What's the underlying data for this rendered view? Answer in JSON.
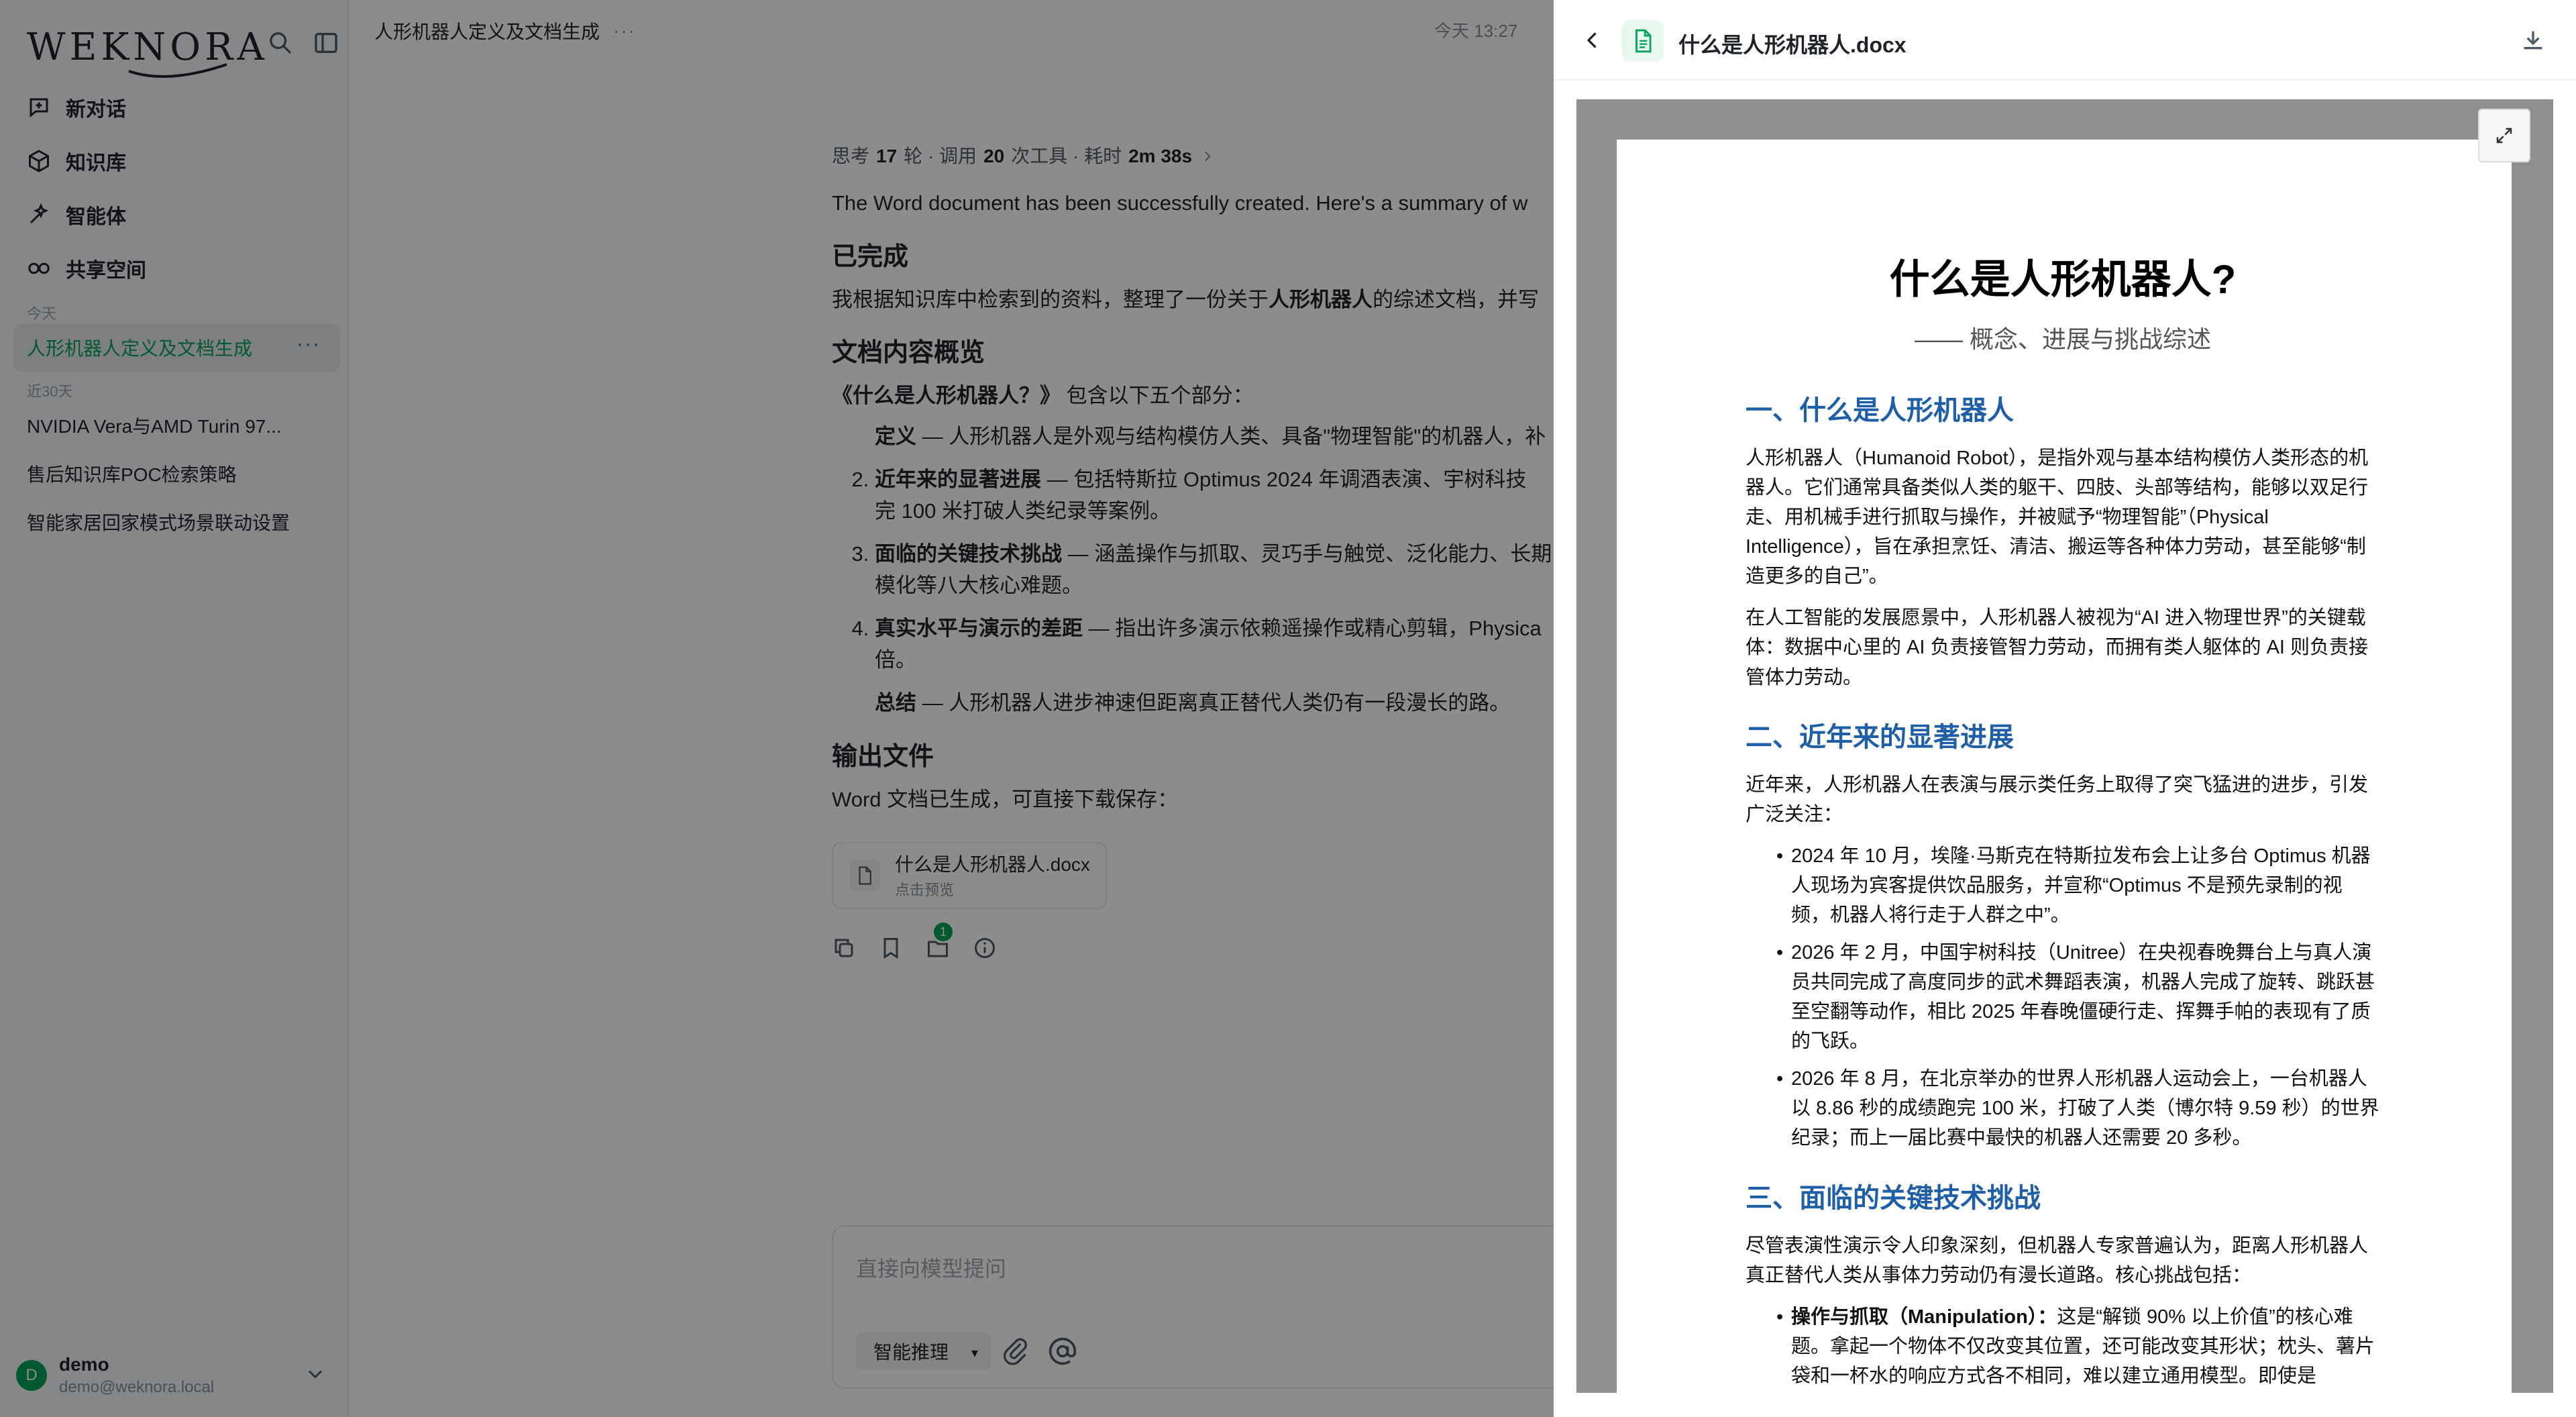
{
  "sidebar": {
    "logo": "WEKNORA",
    "nav": [
      {
        "label": "新对话"
      },
      {
        "label": "知识库"
      },
      {
        "label": "智能体"
      },
      {
        "label": "共享空间"
      }
    ],
    "section_today": "今天",
    "section_30days": "近30天",
    "active_conversation": "人形机器人定义及文档生成",
    "conversations": [
      "NVIDIA Vera与AMD Turin 97...",
      "售后知识库POC检索策略",
      "智能家居回家模式场景联动设置"
    ],
    "user": {
      "initial": "D",
      "name": "demo",
      "email": "demo@weknora.local"
    }
  },
  "chat": {
    "title": "人形机器人定义及文档生成",
    "time": "今天 13:27",
    "thinking": {
      "prefix": "思考",
      "rounds": "17",
      "rounds_unit": "轮 · 调用",
      "tools": "20",
      "tools_unit": "次工具 · 耗时",
      "duration": "2m 38s"
    },
    "intro": "The Word document has been successfully created. Here's a summary of w",
    "done_heading": "已完成",
    "done_text_a": "我根据知识库中检索到的资料，整理了一份关于",
    "done_text_b": "人形机器人",
    "done_text_c": "的综述文档，并写",
    "overview_heading": "文档内容概览",
    "overview_title": "《什么是人形机器人？》",
    "overview_text": " 包含以下五个部分：",
    "items": [
      {
        "term": "定义",
        "desc": " — 人形机器人是外观与结构模仿人类、具备\"物理智能\"的机器人，补"
      },
      {
        "term": "近年来的显著进展",
        "desc": " — 包括特斯拉 Optimus 2024 年调酒表演、宇树科技",
        "desc2": "完 100 米打破人类纪录等案例。"
      },
      {
        "term": "面临的关键技术挑战",
        "desc": " — 涵盖操作与抓取、灵巧手与触觉、泛化能力、长期",
        "desc2": "模化等八大核心难题。"
      },
      {
        "term": "真实水平与演示的差距",
        "desc": " — 指出许多演示依赖遥操作或精心剪辑，Physica",
        "desc2": "倍。"
      },
      {
        "term": "总结",
        "desc": " — 人形机器人进步神速但距离真正替代人类仍有一段漫长的路。"
      }
    ],
    "output_heading": "输出文件",
    "output_text": "Word 文档已生成，可直接下载保存：",
    "file_name": "什么是人形机器人.docx",
    "file_sub": "点击预览",
    "badge": "1",
    "composer_placeholder": "直接向模型提问",
    "mode_label": "智能推理"
  },
  "preview": {
    "title": "什么是人形机器人.docx",
    "doc": {
      "title": "什么是人形机器人?",
      "subtitle": "—— 概念、进展与挑战综述",
      "h1": "一、什么是人形机器人",
      "p1": "人形机器人（Humanoid Robot），是指外观与基本结构模仿人类形态的机器人。它们通常具备类似人类的躯干、四肢、头部等结构，能够以双足行走、用机械手进行抓取与操作，并被赋予“物理智能”（Physical Intelligence），旨在承担烹饪、清洁、搬运等各种体力劳动，甚至能够“制造更多的自己”。",
      "p2": "在人工智能的发展愿景中，人形机器人被视为“AI 进入物理世界”的关键载体：数据中心里的 AI 负责接管智力劳动，而拥有类人躯体的 AI 则负责接管体力劳动。",
      "h2": "二、近年来的显著进展",
      "p3": "近年来，人形机器人在表演与展示类任务上取得了突飞猛进的进步，引发广泛关注：",
      "bullets": [
        "2024 年 10 月，埃隆·马斯克在特斯拉发布会上让多台 Optimus 机器人现场为宾客提供饮品服务，并宣称“Optimus 不是预先录制的视频，机器人将行走于人群之中”。",
        "2026 年 2 月，中国宇树科技（Unitree）在央视春晚舞台上与真人演员共同完成了高度同步的武术舞蹈表演，机器人完成了旋转、跳跃甚至空翻等动作，相比 2025 年春晚僵硬行走、挥舞手帕的表现有了质的飞跃。",
        "2026 年 8 月，在北京举办的世界人形机器人运动会上，一台机器人以 8.86 秒的成绩跑完 100 米，打破了人类（博尔特 9.59 秒）的世界纪录；而上一届比赛中最快的机器人还需要 20 多秒。"
      ],
      "h3": "三、面临的关键技术挑战",
      "p4": "尽管表演性演示令人印象深刻，但机器人专家普遍认为，距离人形机器人真正替代人类从事体力劳动仍有漫长道路。核心挑战包括：",
      "b4_term": "操作与抓取（Manipulation）：",
      "b4_desc": "这是“解锁 90% 以上价值”的核心难题。拿起一个物体不仅改变其位置，还可能改变其形状；枕头、薯片袋和一杯水的响应方式各不相同，难以建立通用模型。即使是"
    }
  }
}
